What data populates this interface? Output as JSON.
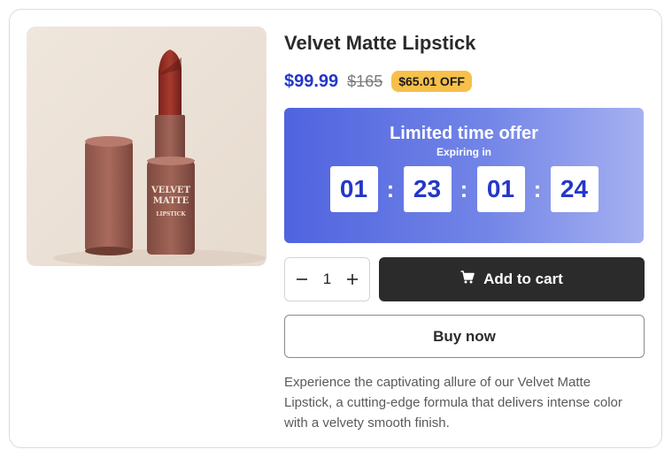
{
  "product": {
    "title": "Velvet Matte Lipstick",
    "price": "$99.99",
    "original_price": "$165",
    "discount": "$65.01 OFF",
    "image_alt": "Velvet Matte Lipstick product photo",
    "image_text": [
      "VELVET",
      "MATTE",
      "LIPSTICK"
    ]
  },
  "offer": {
    "title": "Limited time offer",
    "subtitle": "Expiring in",
    "timer": [
      "01",
      "23",
      "01",
      "24"
    ],
    "separator": ":"
  },
  "cart": {
    "quantity": "1",
    "minus_icon": "minus-icon",
    "plus_icon": "plus-icon",
    "add_label": "Add to cart",
    "cart_icon": "cart-icon"
  },
  "buy_now_label": "Buy now",
  "description": "Experience the captivating allure of our Velvet Matte Lipstick, a cutting-edge formula that delivers intense color with a velvety smooth finish.",
  "colors": {
    "accent": "#2437c9",
    "badge": "#f7c04a",
    "dark": "#2b2b2b"
  }
}
